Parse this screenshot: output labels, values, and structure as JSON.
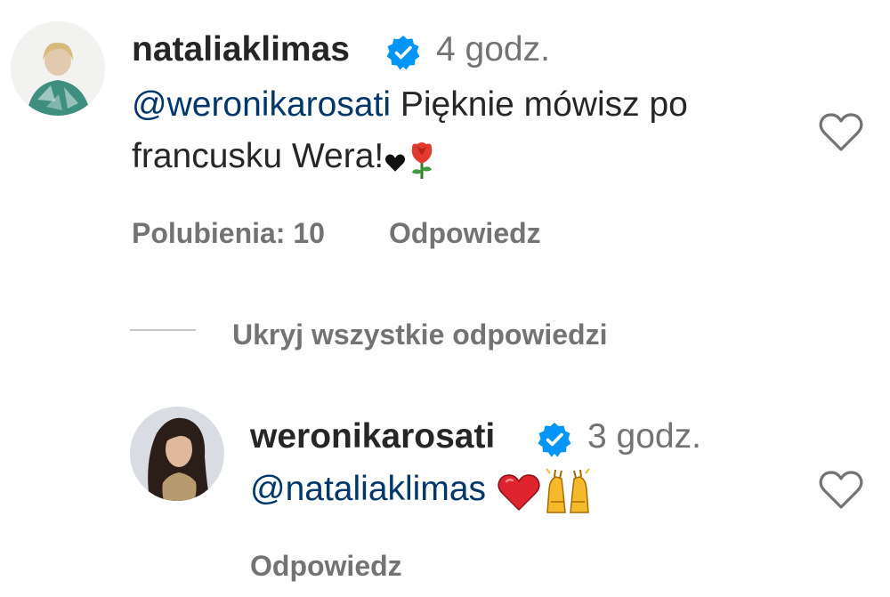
{
  "comment": {
    "username": "nataliaklimas",
    "verified_icon": "verified-badge-icon",
    "time": "4 godz.",
    "mention": "@weronikarosati",
    "text_line1": " Pięknie mówisz po",
    "text_line2": "francusku Wera!",
    "emojis": [
      "black-heart",
      "rose"
    ],
    "likes_label": "Polubienia: 10",
    "reply_label": "Odpowiedz"
  },
  "hide_replies_label": "Ukryj wszystkie odpowiedzi",
  "reply": {
    "username": "weronikarosati",
    "verified_icon": "verified-badge-icon",
    "time": "3 godz.",
    "mention": "@nataliaklimas",
    "emojis": [
      "red-heart",
      "raising-hands"
    ],
    "reply_label": "Odpowiedz"
  },
  "colors": {
    "text": "#262626",
    "secondary": "#737373",
    "mention": "#00376b",
    "verified": "#0095f6",
    "divider": "#c7c7c7"
  }
}
